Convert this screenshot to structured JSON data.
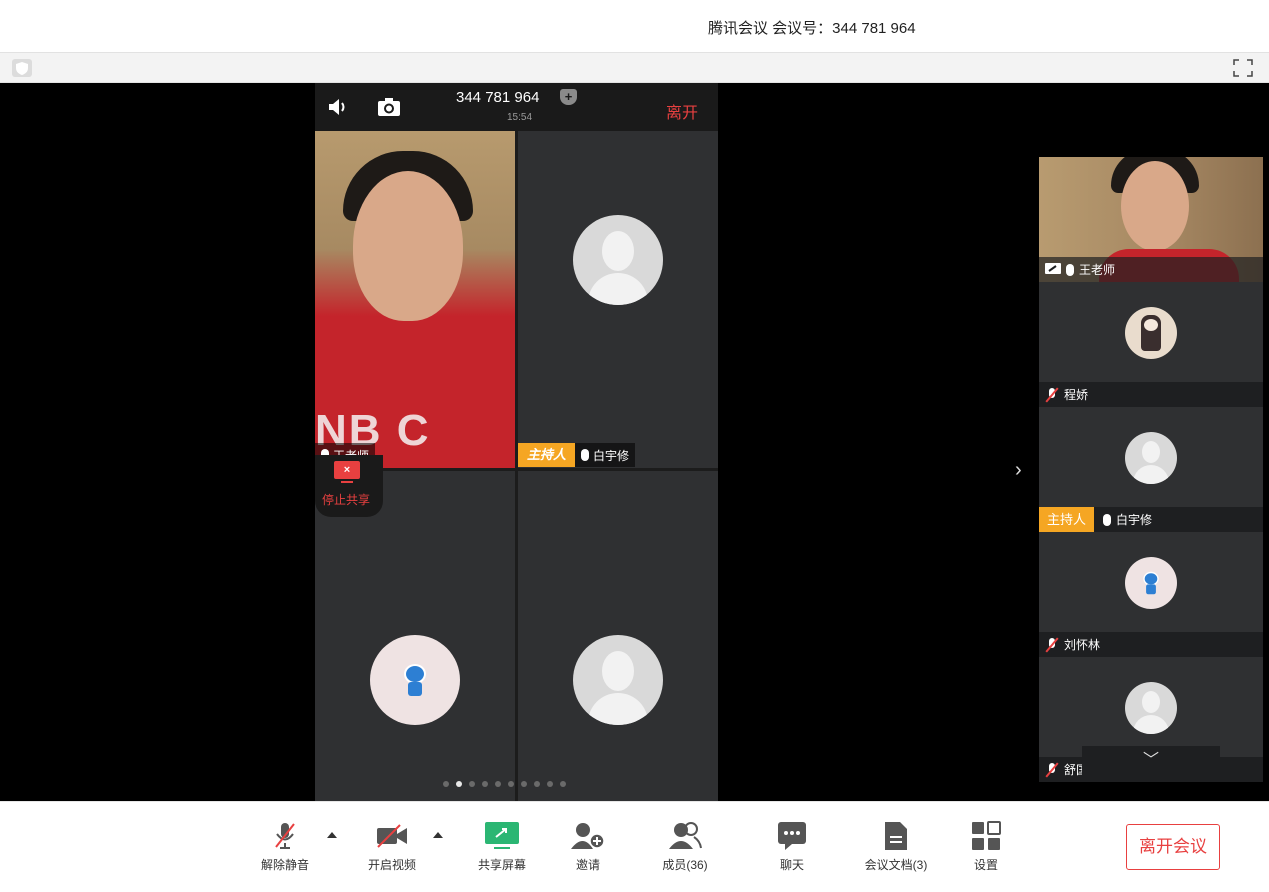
{
  "window": {
    "title": "腾讯会议 会议号：344 781 964"
  },
  "phone": {
    "meeting_no": "344 781 964",
    "time": "15:54",
    "leave_label": "离开",
    "tiles": [
      {
        "name": "王老师"
      },
      {
        "host_tag": "主持人",
        "name": "白宇修"
      },
      {
        "name": ""
      },
      {
        "name": ""
      }
    ],
    "stop_share_label": "停止共享",
    "shirt_text": "NB C"
  },
  "panel": {
    "participants": [
      {
        "name": "王老师"
      },
      {
        "name": "程娇"
      },
      {
        "host_tag": "主持人",
        "name": "白宇修"
      },
      {
        "name": "刘怀林"
      },
      {
        "name": "舒国伟"
      }
    ],
    "chevron_right": "›",
    "chevron_down": "﹀"
  },
  "toolbar": {
    "unmute": "解除静音",
    "start_video": "开启视频",
    "share_screen": "共享屏幕",
    "invite": "邀请",
    "members": "成员(36)",
    "chat": "聊天",
    "docs": "会议文档(3)",
    "settings": "设置",
    "leave_meeting": "离开会议"
  },
  "colors": {
    "accent_red": "#e84040",
    "host_orange": "#f5a623",
    "share_green": "#2bb673"
  }
}
